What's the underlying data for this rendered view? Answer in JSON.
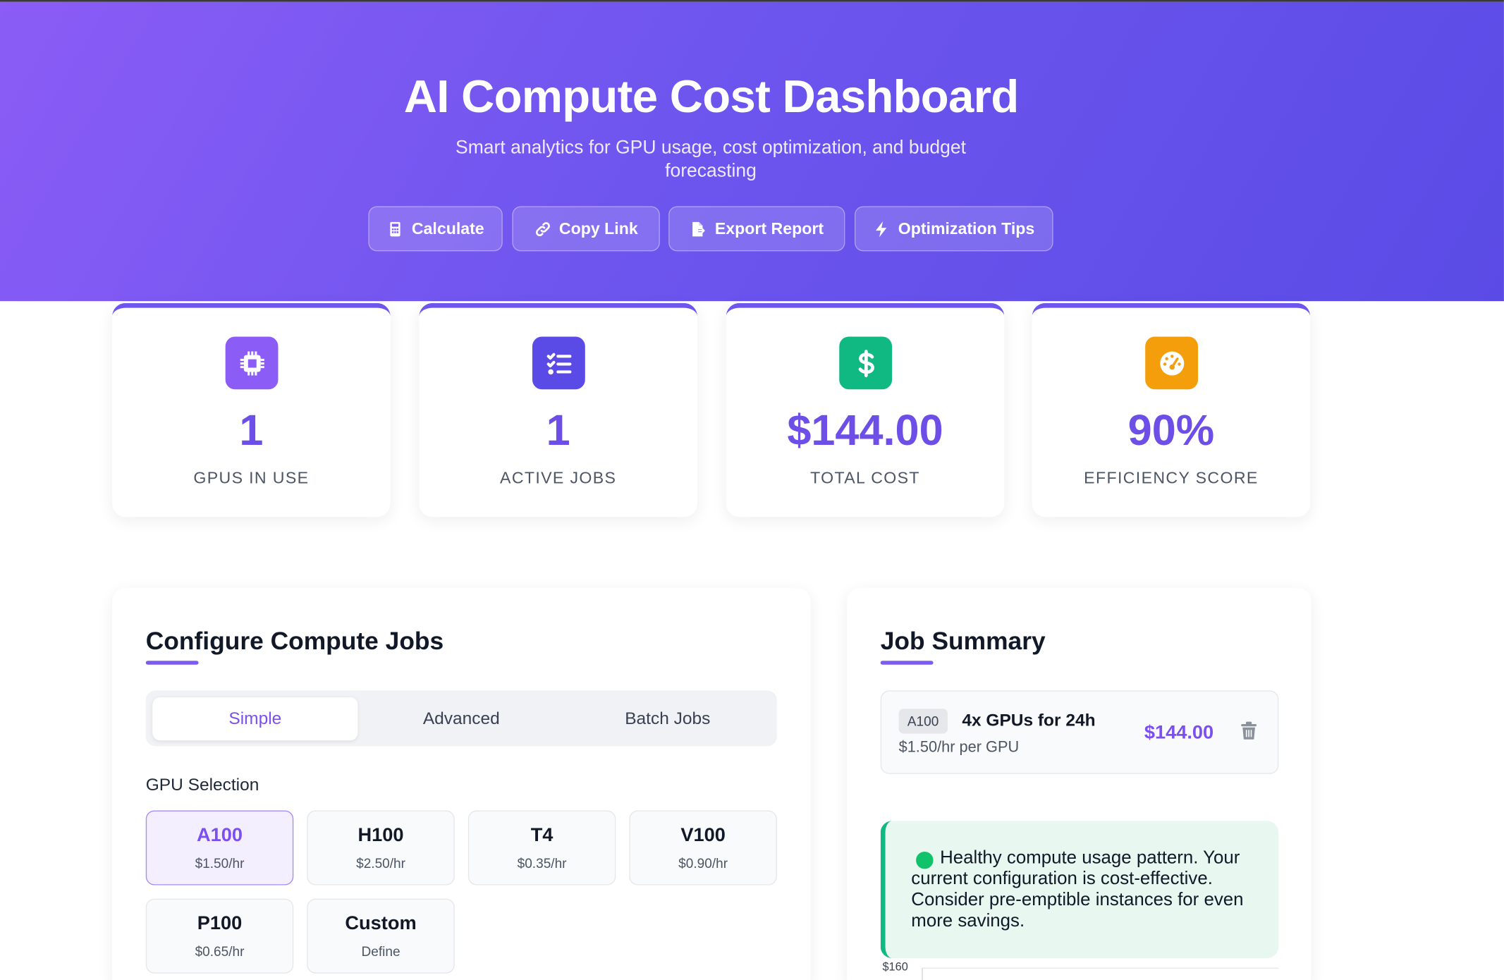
{
  "header": {
    "title": "AI Compute Cost Dashboard",
    "subtitle": "Smart analytics for GPU usage, cost optimization, and budget forecasting",
    "buttons": [
      {
        "label": "Calculate",
        "icon": "calculator-icon"
      },
      {
        "label": "Copy Link",
        "icon": "link-icon"
      },
      {
        "label": "Export Report",
        "icon": "export-file-icon"
      },
      {
        "label": "Optimization Tips",
        "icon": "bolt-icon"
      }
    ]
  },
  "stats": [
    {
      "value": "1",
      "label": "GPUS IN USE",
      "icon": "chip-icon",
      "color": "#8b5cf6"
    },
    {
      "value": "1",
      "label": "ACTIVE JOBS",
      "icon": "checklist-icon",
      "color": "#5b4be6"
    },
    {
      "value": "$144.00",
      "label": "TOTAL COST",
      "icon": "dollar-icon",
      "color": "#10b981"
    },
    {
      "value": "90%",
      "label": "EFFICIENCY SCORE",
      "icon": "gauge-icon",
      "color": "#f59e0b"
    }
  ],
  "configure": {
    "title": "Configure Compute Jobs",
    "tabs": [
      "Simple",
      "Advanced",
      "Batch Jobs"
    ],
    "active_tab": "Simple",
    "gpu_selection_label": "GPU Selection",
    "gpus": [
      {
        "name": "A100",
        "price": "$1.50/hr",
        "selected": true
      },
      {
        "name": "H100",
        "price": "$2.50/hr",
        "selected": false
      },
      {
        "name": "T4",
        "price": "$0.35/hr",
        "selected": false
      },
      {
        "name": "V100",
        "price": "$0.90/hr",
        "selected": false
      },
      {
        "name": "P100",
        "price": "$0.65/hr",
        "selected": false
      },
      {
        "name": "Custom",
        "price": "Define",
        "selected": false
      }
    ]
  },
  "summary": {
    "title": "Job Summary",
    "job": {
      "tag": "A100",
      "title": "4x GPUs for 24h",
      "rate": "$1.50/hr per GPU",
      "cost": "$144.00"
    },
    "note": "Healthy compute usage pattern. Your current configuration is cost-effective. Consider pre-emptible instances for even more savings.",
    "chart_axis_top": "$160"
  },
  "colors": {
    "accent": "#7c4ff0",
    "header_gradient_start": "#8b5cf6",
    "header_gradient_end": "#5b4be6",
    "success": "#10b981"
  }
}
